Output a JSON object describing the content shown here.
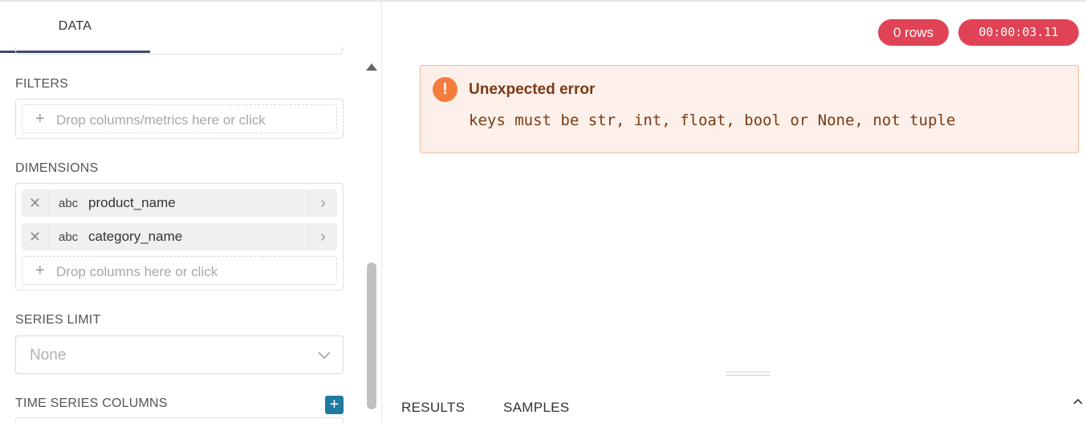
{
  "tabs": {
    "data_label": "DATA"
  },
  "filters": {
    "label": "FILTERS",
    "drop_placeholder": "Drop columns/metrics here or click"
  },
  "dimensions": {
    "label": "DIMENSIONS",
    "items": [
      {
        "type": "abc",
        "name": "product_name"
      },
      {
        "type": "abc",
        "name": "category_name"
      }
    ],
    "drop_placeholder": "Drop columns here or click"
  },
  "series_limit": {
    "label": "SERIES LIMIT",
    "value": "None"
  },
  "time_series_columns": {
    "label": "TIME SERIES COLUMNS"
  },
  "status": {
    "rows": "0 rows",
    "elapsed": "00:00:03.11"
  },
  "error": {
    "title": "Unexpected error",
    "message": "keys must be str, int, float, bool or None, not tuple"
  },
  "results_tabs": {
    "results": "RESULTS",
    "samples": "SAMPLES"
  },
  "colors": {
    "badge": "#e04355",
    "error_bg": "#fdf0ea",
    "error_border": "#f2b995",
    "error_icon": "#f57c3d",
    "add_button": "#1f7a9e",
    "tab_underline": "#3e4a6b"
  },
  "icons": {
    "remove": "close-icon",
    "expand": "chevron-right-icon",
    "add": "plus-icon",
    "select": "chevron-down-icon",
    "error": "exclamation-icon",
    "collapse": "chevron-up-icon"
  }
}
